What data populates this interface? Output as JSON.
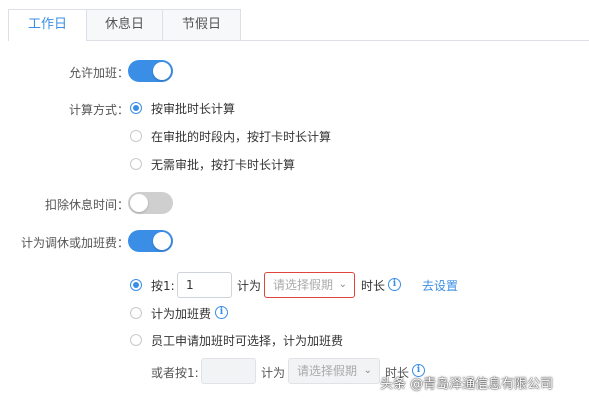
{
  "tabs": [
    {
      "label": "工作日",
      "active": true
    },
    {
      "label": "休息日",
      "active": false
    },
    {
      "label": "节假日",
      "active": false
    }
  ],
  "allow_overtime": {
    "label": "允许加班：",
    "on": true
  },
  "calc_method": {
    "label": "计算方式：",
    "options": [
      {
        "label": "按审批时长计算",
        "checked": true
      },
      {
        "label": "在审批的时段内，按打卡时长计算",
        "checked": false
      },
      {
        "label": "无需审批，按打卡时长计算",
        "checked": false
      }
    ]
  },
  "deduct_rest": {
    "label": "扣除休息时间：",
    "on": false
  },
  "count_as": {
    "label": "计为调休或加班费：",
    "on": true
  },
  "sub_options": {
    "opt1": {
      "prefix": "按1:",
      "value": "1",
      "mid": "计为",
      "select_placeholder": "请选择假期",
      "suffix": "时长",
      "link": "去设置",
      "checked": true
    },
    "opt2": {
      "label": "计为加班费",
      "checked": false
    },
    "opt3": {
      "label": "员工申请加班时可选择，计为加班费",
      "checked": false
    },
    "opt3_row": {
      "prefix": "或者按1:",
      "value": "",
      "mid": "计为",
      "select_placeholder": "请选择假期",
      "suffix": "时长"
    }
  },
  "icons": {
    "info": "info-icon",
    "chevron": "chevron-down-icon"
  },
  "colors": {
    "accent": "#3a8ee6",
    "error": "#e0443a",
    "switch_off": "#cfcfcf"
  },
  "watermark": "头条 @青岛泽通信息有限公司"
}
